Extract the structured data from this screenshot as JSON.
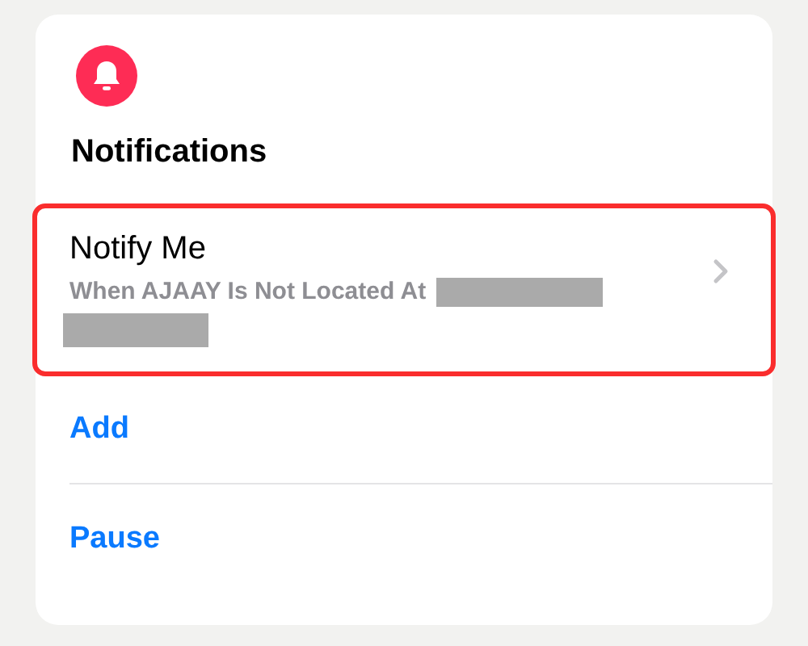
{
  "section": {
    "title": "Notifications"
  },
  "rule": {
    "title": "Notify Me",
    "subtitle": "When AJAAY Is Not Located At",
    "highlighted": true
  },
  "actions": [
    {
      "label": "Add"
    },
    {
      "label": "Pause"
    }
  ]
}
